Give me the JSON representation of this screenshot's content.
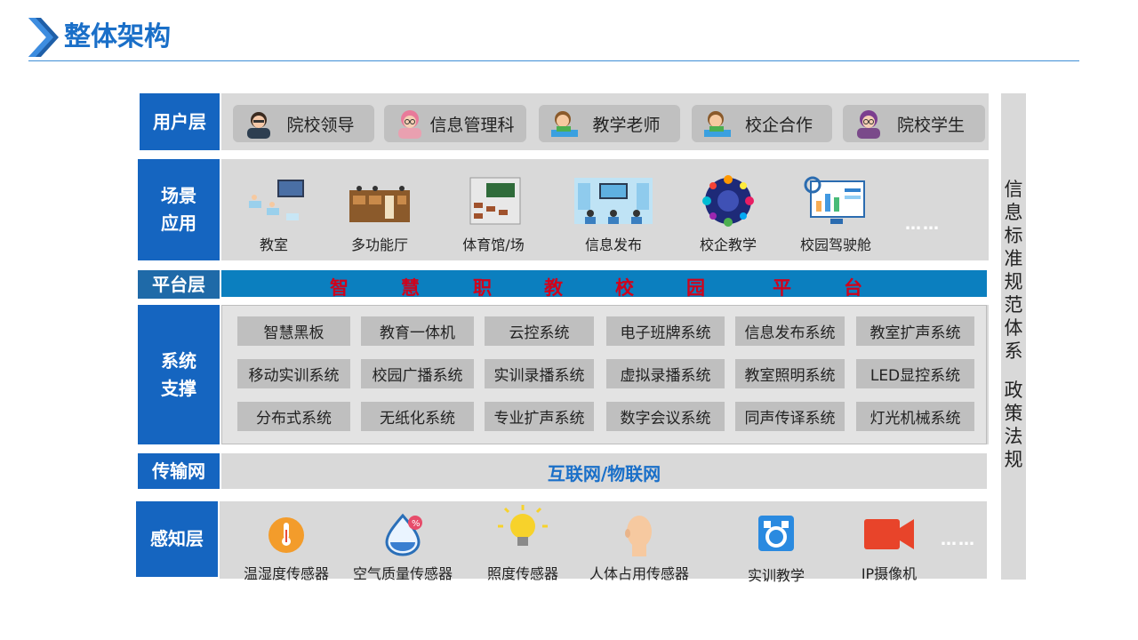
{
  "header": {
    "title": "整体架构"
  },
  "layers": {
    "user": {
      "label": "用户层",
      "items": [
        {
          "label": "院校领导",
          "icon": "leader-avatar-icon"
        },
        {
          "label": "信息管理科",
          "icon": "manager-avatar-icon"
        },
        {
          "label": "教学老师",
          "icon": "teacher-avatar-icon"
        },
        {
          "label": "校企合作",
          "icon": "cooperation-avatar-icon"
        },
        {
          "label": "院校学生",
          "icon": "student-avatar-icon"
        }
      ]
    },
    "scenario": {
      "label_line1": "场景",
      "label_line2": "应用",
      "items": [
        {
          "label": "教室",
          "icon": "classroom-icon"
        },
        {
          "label": "多功能厅",
          "icon": "hall-icon"
        },
        {
          "label": "体育馆/场",
          "icon": "gym-icon"
        },
        {
          "label": "信息发布",
          "icon": "info-release-icon"
        },
        {
          "label": "校企教学",
          "icon": "enterprise-teaching-icon"
        },
        {
          "label": "校园驾驶舱",
          "icon": "dashboard-icon"
        }
      ],
      "more": "……"
    },
    "platform": {
      "label": "平台层",
      "chars": [
        "智",
        "慧",
        "职",
        "教",
        "校",
        "园",
        "平",
        "台"
      ]
    },
    "system": {
      "label_line1": "系统",
      "label_line2": "支撑",
      "rows": [
        [
          "智慧黑板",
          "教育一体机",
          "云控系统",
          "电子班牌系统",
          "信息发布系统",
          "教室扩声系统"
        ],
        [
          "移动实训系统",
          "校园广播系统",
          "实训录播系统",
          "虚拟录播系统",
          "教室照明系统",
          "LED显控系统"
        ],
        [
          "分布式系统",
          "无纸化系统",
          "专业扩声系统",
          "数字会议系统",
          "同声传译系统",
          "灯光机械系统"
        ]
      ]
    },
    "network": {
      "label": "传输网",
      "content": "互联网/物联网"
    },
    "sensing": {
      "label": "感知层",
      "items": [
        {
          "label": "温湿度传感器",
          "icon": "thermometer-icon"
        },
        {
          "label": "空气质量传感器",
          "icon": "air-quality-icon"
        },
        {
          "label": "照度传感器",
          "icon": "lightbulb-icon"
        },
        {
          "label": "人体占用传感器",
          "icon": "human-head-icon"
        },
        {
          "label": "实训教学",
          "icon": "training-icon"
        },
        {
          "label": "IP摄像机",
          "icon": "camera-icon"
        }
      ],
      "more": "……"
    }
  },
  "side": {
    "chars": [
      "信",
      "息",
      "标",
      "准",
      "规",
      "范",
      "体",
      "系",
      "",
      "政",
      "策",
      "法",
      "规"
    ]
  },
  "colors": {
    "accent": "#1565c0",
    "platform_bar": "#0b7fbf",
    "platform_text": "#d0021b",
    "panel": "#d9d9d9"
  }
}
